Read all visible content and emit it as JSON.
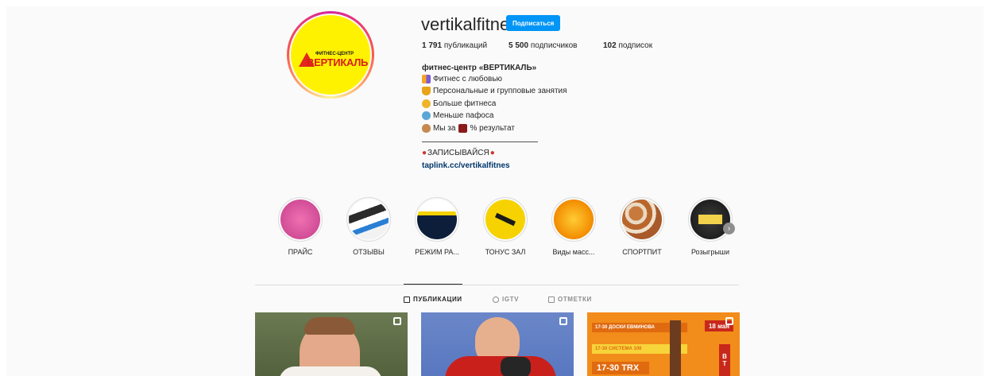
{
  "profile": {
    "username": "vertikalfitnes",
    "follow_label": "Подписаться",
    "avatar": {
      "logo_small": "ФИТНЕС-ЦЕНТР",
      "logo_big": "ВЕРТИКАЛЬ",
      "bg_color": "#fff200"
    }
  },
  "stats": {
    "posts_count": "1 791",
    "posts_label": "публикаций",
    "followers_count": "5 500",
    "followers_label": "подписчиков",
    "following_count": "102",
    "following_label": "подписок"
  },
  "bio": {
    "name": "фитнес-центр «ВЕРТИКАЛЬ»",
    "lines": [
      {
        "icon": "people-emoji-icon",
        "text": "Фитнес с любовью"
      },
      {
        "icon": "trophy-emoji-icon",
        "text": "Персональные и групповые занятия"
      },
      {
        "icon": "medal-emoji-icon",
        "text": "Больше фитнеса"
      },
      {
        "icon": "medal-blue-emoji-icon",
        "text": "Меньше пафоса"
      },
      {
        "icon": "muscle-emoji-icon",
        "text": "Мы за",
        "icon2": "hundred-emoji-icon",
        "text2": "% результат"
      }
    ],
    "cta": "ЗАПИСЫВАЙСЯ",
    "link": "taplink.cc/vertikalfitnes"
  },
  "highlights": [
    {
      "label": "ПРАЙС",
      "icon": "price-highlight"
    },
    {
      "label": "ОТЗЫВЫ",
      "icon": "reviews-highlight"
    },
    {
      "label": "РЕЖИМ РА...",
      "icon": "schedule-highlight"
    },
    {
      "label": "ТОНУС ЗАЛ",
      "icon": "tonus-highlight"
    },
    {
      "label": "Виды масс...",
      "icon": "massage-highlight"
    },
    {
      "label": "СПОРТПИТ",
      "icon": "sportpit-highlight"
    },
    {
      "label": "Розыгрыши",
      "icon": "giveaway-highlight"
    }
  ],
  "tabs": [
    {
      "label": "ПУБЛИКАЦИИ",
      "active": true,
      "icon": "grid-icon"
    },
    {
      "label": "IGTV",
      "active": false,
      "icon": "igtv-icon"
    },
    {
      "label": "ОТМЕТКИ",
      "active": false,
      "icon": "tagged-icon"
    }
  ],
  "posts": [
    {
      "name": "post-1",
      "desc": "man portrait"
    },
    {
      "name": "post-2",
      "desc": "fighter in red"
    },
    {
      "name": "post-3",
      "schedule": [
        "17-30 ДОСКИ ЕВМИНОВА",
        "17-30 СИСТЕМА 100",
        "17-30 TRX"
      ],
      "date": "18 мая",
      "day": "ВТ"
    }
  ],
  "colors": {
    "accent": "#0095f6",
    "link": "#00376b",
    "bg": "#fafafa"
  }
}
